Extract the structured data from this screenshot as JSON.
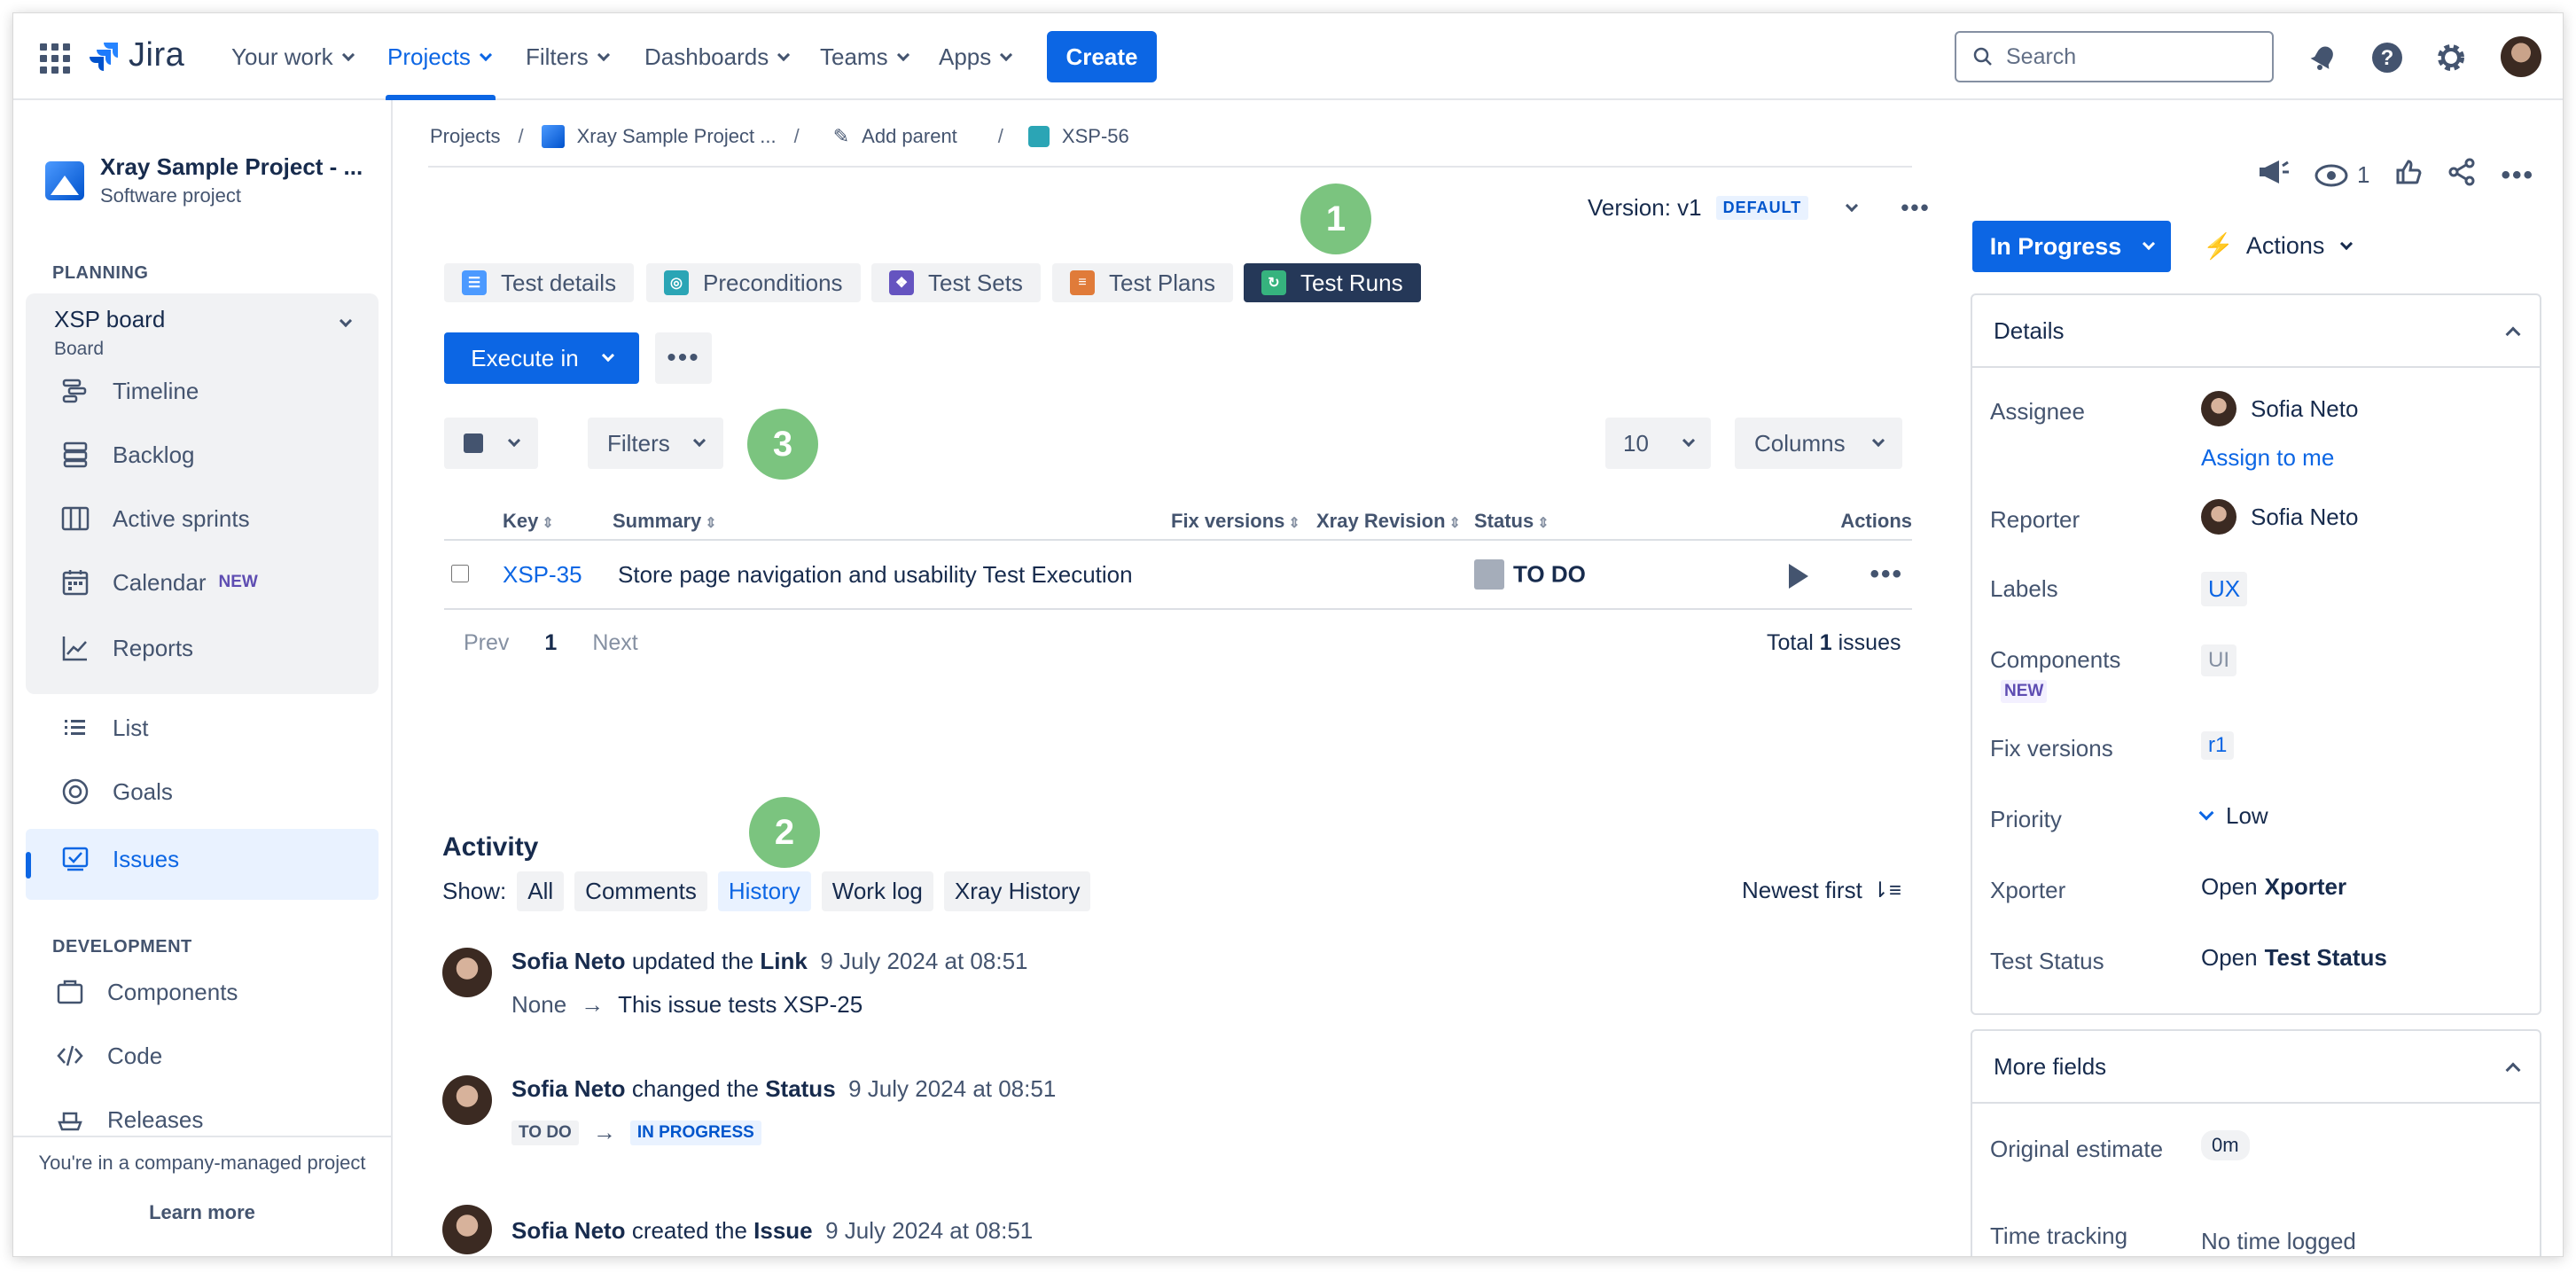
{
  "topnav": {
    "logo_text": "Jira",
    "your_work": "Your work",
    "projects": "Projects",
    "filters": "Filters",
    "dashboards": "Dashboards",
    "teams": "Teams",
    "apps": "Apps",
    "create": "Create",
    "search_placeholder": "Search",
    "accent": "#0C66E4"
  },
  "sidebar": {
    "project_name": "Xray Sample Project - ...",
    "project_type": "Software project",
    "planning_label": "PLANNING",
    "board_title": "XSP board",
    "board_sub": "Board",
    "items": {
      "timeline": "Timeline",
      "backlog": "Backlog",
      "active_sprints": "Active sprints",
      "calendar": "Calendar",
      "calendar_badge": "NEW",
      "reports": "Reports",
      "list": "List",
      "goals": "Goals",
      "issues": "Issues"
    },
    "development_label": "DEVELOPMENT",
    "dev_items": {
      "components": "Components",
      "code": "Code",
      "releases": "Releases"
    },
    "footer_text": "You're in a company-managed project",
    "footer_link": "Learn more"
  },
  "breadcrumb": {
    "projects": "Projects",
    "project": "Xray Sample Project ...",
    "add_parent": "Add parent",
    "issue_key": "XSP-56"
  },
  "version": {
    "label": "Version: v1",
    "badge": "DEFAULT"
  },
  "markers": {
    "m1": "1",
    "m2": "2",
    "m3": "3"
  },
  "tabs": [
    {
      "label": "Test details",
      "color": "#4C9AFF"
    },
    {
      "label": "Preconditions",
      "color": "#2BA5B5"
    },
    {
      "label": "Test Sets",
      "color": "#6554C0"
    },
    {
      "label": "Test Plans",
      "color": "#E07B39"
    },
    {
      "label": "Test Runs",
      "color": "#36B37E"
    }
  ],
  "toolbar": {
    "execute_in": "Execute in",
    "filters": "Filters",
    "page_size": "10",
    "columns": "Columns"
  },
  "table": {
    "headers": {
      "key": "Key",
      "summary": "Summary",
      "fix_versions": "Fix versions",
      "xray_revision": "Xray Revision",
      "status": "Status",
      "actions": "Actions"
    },
    "rows": [
      {
        "key": "XSP-35",
        "summary": "Store page navigation and usability Test Execution",
        "status": "TO DO"
      }
    ],
    "pager": {
      "prev": "Prev",
      "page": "1",
      "next": "Next"
    },
    "total_prefix": "Total",
    "total_count": "1",
    "total_suffix": "issues"
  },
  "activity": {
    "title": "Activity",
    "show_label": "Show:",
    "filters": {
      "all": "All",
      "comments": "Comments",
      "history": "History",
      "work_log": "Work log",
      "xray_history": "Xray History"
    },
    "sort": "Newest first",
    "entries": [
      {
        "who": "Sofia Neto",
        "verb": "updated the",
        "what": "Link",
        "when": "9 July 2024 at 08:51",
        "from": "None",
        "to": "This issue tests XSP-25"
      },
      {
        "who": "Sofia Neto",
        "verb": "changed the",
        "what": "Status",
        "when": "9 July 2024 at 08:51",
        "from": "TO DO",
        "to": "IN PROGRESS"
      },
      {
        "who": "Sofia Neto",
        "verb": "created the",
        "what": "Issue",
        "when": "9 July 2024 at 08:51"
      }
    ]
  },
  "right_panel": {
    "watch_count": "1",
    "status": "In Progress",
    "actions": "Actions",
    "details_title": "Details",
    "fields": {
      "assignee_label": "Assignee",
      "assignee": "Sofia Neto",
      "assign_to_me": "Assign to me",
      "reporter_label": "Reporter",
      "reporter": "Sofia Neto",
      "labels_label": "Labels",
      "labels": "UX",
      "components_label": "Components",
      "components_badge": "NEW",
      "components": "UI",
      "fix_versions_label": "Fix versions",
      "fix_versions": "r1",
      "priority_label": "Priority",
      "priority": "Low",
      "xporter_label": "Xporter",
      "xporter_prefix": "Open",
      "xporter": "Xporter",
      "test_status_label": "Test Status",
      "test_status_prefix": "Open",
      "test_status": "Test Status"
    },
    "more_fields_title": "More fields",
    "more": {
      "original_estimate_label": "Original estimate",
      "original_estimate": "0m",
      "time_tracking_label": "Time tracking",
      "time_tracking": "No time logged"
    }
  }
}
